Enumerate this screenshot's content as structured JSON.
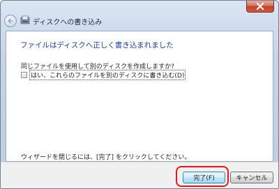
{
  "window": {
    "title": "ディスクへの書き込み"
  },
  "content": {
    "heading": "ファイルはディスクへ正しく書き込まれました",
    "question": "同じファイルを使用して別のディスクを作成しますか?",
    "checkbox_label": "はい、これらのファイルを別のディスクに書き込む(D)",
    "checkbox_checked": false,
    "hint": "ウィザードを閉じるには、[完了] をクリックしてください。"
  },
  "footer": {
    "finish_label": "完了(F)",
    "cancel_label": "キャンセル"
  },
  "colors": {
    "heading": "#1e3f9e",
    "highlight": "#e8141b"
  }
}
